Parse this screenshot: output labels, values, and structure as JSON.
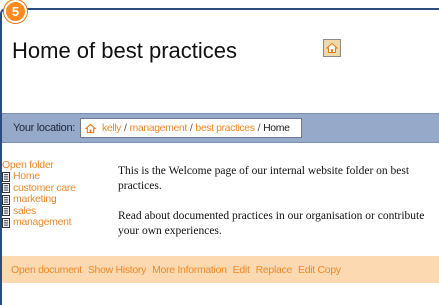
{
  "step_badge": "5",
  "page_title": "Home of best practices",
  "location": {
    "label": "Your location:",
    "crumbs": [
      "kelly",
      "management",
      "best practices"
    ],
    "separator": "/",
    "current": "Home"
  },
  "sidebar": {
    "heading": "Open folder",
    "items": [
      "Home",
      "customer care",
      "marketing",
      "sales",
      "management"
    ]
  },
  "content": {
    "paragraph1": "This is the Welcome page of our internal website folder on best practices.",
    "paragraph2": "Read about documented practices in our organisation or contribute your own experiences."
  },
  "actions": [
    "Open document",
    "Show History",
    "More Information",
    "Edit",
    "Replace",
    "Edit Copy"
  ],
  "colors": {
    "accent": "#ea8a2a",
    "location_bar": "#97a9c8",
    "action_bar": "#fcd9b0",
    "frame": "#2b4c7e",
    "badge": "#ff8a1f"
  },
  "icons": {
    "home_button": "home-icon",
    "location": "house-icon",
    "sidebar_items": "document-icon"
  }
}
